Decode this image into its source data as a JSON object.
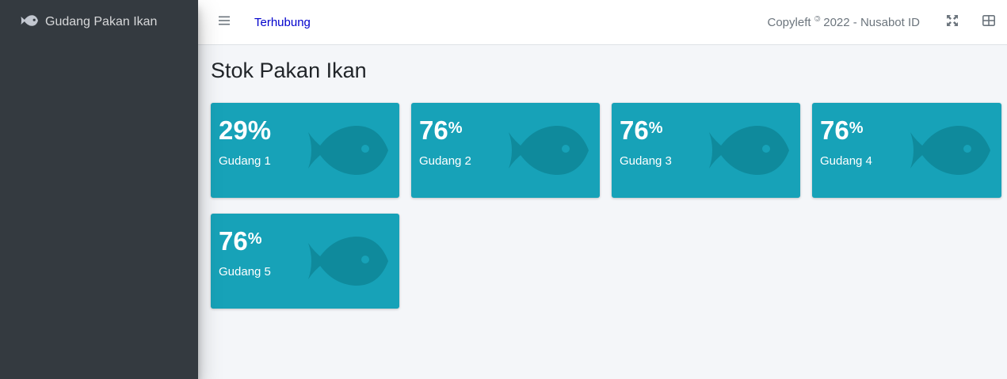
{
  "sidebar": {
    "brand_label": "Gudang Pakan Ikan",
    "brand_icon": "fish-icon"
  },
  "navbar": {
    "status": "Terhubung",
    "copyleft_prefix": "Copyleft",
    "copyleft_symbol": "©",
    "copyleft_suffix": "2022 - Nusabot ID",
    "icons": [
      "menu-icon",
      "fullscreen-icon",
      "widgets-icon"
    ]
  },
  "page": {
    "title": "Stok Pakan Ikan"
  },
  "colors": {
    "sidebar_bg": "#343a40",
    "card_bg": "#17a2b8",
    "card_icon": "#0f8a9c",
    "status_text": "#0000cc"
  },
  "warehouses": [
    {
      "name": "Gudang 1",
      "value": "29",
      "unit": "%",
      "unit_style": "inline"
    },
    {
      "name": "Gudang 2",
      "value": "76",
      "unit": "%",
      "unit_style": "superscript"
    },
    {
      "name": "Gudang 3",
      "value": "76",
      "unit": "%",
      "unit_style": "superscript"
    },
    {
      "name": "Gudang 4",
      "value": "76",
      "unit": "%",
      "unit_style": "superscript"
    },
    {
      "name": "Gudang 5",
      "value": "76",
      "unit": "%",
      "unit_style": "superscript"
    }
  ]
}
